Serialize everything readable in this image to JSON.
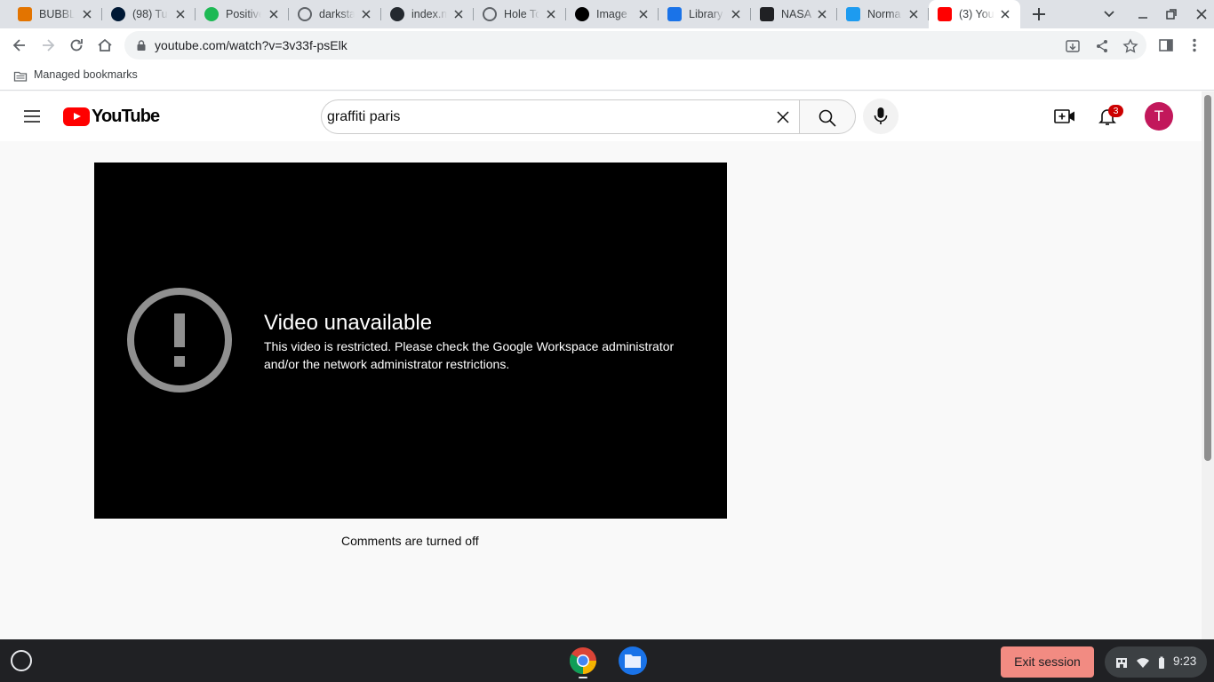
{
  "browser": {
    "tabs": [
      {
        "label": "BUBBLE",
        "icon": "bubble-icon",
        "color": "#e37400"
      },
      {
        "label": "(98) Tu",
        "icon": "tumblr-icon",
        "color": "#001935"
      },
      {
        "label": "Positive",
        "icon": "spotify-icon",
        "color": "#1db954"
      },
      {
        "label": "darksta",
        "icon": "globe-icon",
        "color": "#5f6368"
      },
      {
        "label": "index.m",
        "icon": "github-icon",
        "color": "#24292f"
      },
      {
        "label": "Hole To",
        "icon": "globe-icon",
        "color": "#5f6368"
      },
      {
        "label": "Image",
        "icon": "codepen-icon",
        "color": "#000000"
      },
      {
        "label": "Library",
        "icon": "lb-icon",
        "color": "#1a73e8"
      },
      {
        "label": "NASA",
        "icon": "nasa-icon",
        "color": "#202124"
      },
      {
        "label": "Norma",
        "icon": "twitter-icon",
        "color": "#1d9bf0"
      },
      {
        "label": "(3) You",
        "icon": "youtube-icon",
        "color": "#ff0000"
      }
    ],
    "url": "youtube.com/watch?v=3v33f-psElk",
    "bookmarks_label": "Managed bookmarks"
  },
  "youtube": {
    "logo_text": "YouTube",
    "search_query": "graffiti paris",
    "notification_count": "3",
    "avatar_letter": "T",
    "avatar_color": "#c2185b",
    "error_title": "Video unavailable",
    "error_message": "This video is restricted. Please check the Google Workspace administrator and/or the network administrator restrictions.",
    "comments_status": "Comments are turned off"
  },
  "shelf": {
    "exit_label": "Exit session",
    "time": "9:23"
  }
}
